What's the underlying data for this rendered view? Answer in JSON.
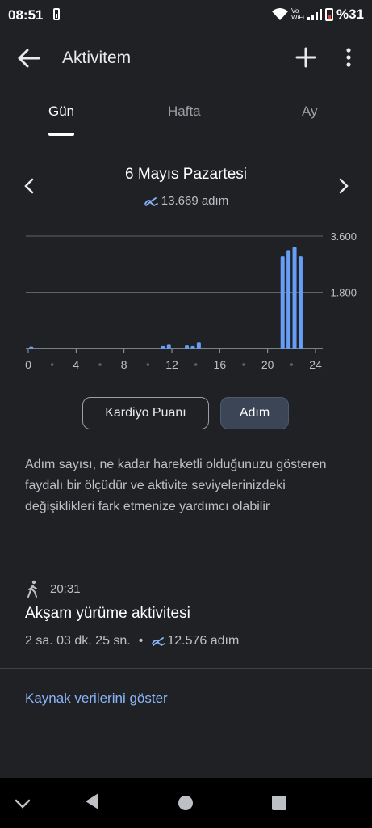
{
  "status": {
    "time": "08:51",
    "battery": "%31",
    "volte_top": "Vo",
    "volte_bottom": "WiFi"
  },
  "appbar": {
    "title": "Aktivitem"
  },
  "tabs": [
    {
      "label": "Gün"
    },
    {
      "label": "Hafta"
    },
    {
      "label": "Ay"
    }
  ],
  "day": {
    "title": "6 Mayıs Pazartesi",
    "steps": "13.669 adım"
  },
  "chart_data": {
    "type": "bar",
    "x": [
      0,
      0.5,
      1,
      1.5,
      2,
      2.5,
      3,
      3.5,
      4,
      4.5,
      5,
      5.5,
      6,
      6.5,
      7,
      7.5,
      8,
      8.5,
      9,
      9.5,
      10,
      10.5,
      11,
      11.5,
      12,
      12.5,
      13,
      13.5,
      14,
      14.5,
      15,
      15.5,
      16,
      16.5,
      17,
      17.5,
      18,
      18.5,
      19,
      19.5,
      20,
      20.5,
      21,
      21.5,
      22,
      22.5,
      23,
      23.5
    ],
    "values": [
      60,
      0,
      0,
      0,
      0,
      0,
      0,
      0,
      0,
      0,
      0,
      0,
      0,
      0,
      0,
      0,
      0,
      0,
      0,
      0,
      0,
      0,
      80,
      120,
      0,
      0,
      100,
      80,
      200,
      0,
      0,
      0,
      0,
      0,
      0,
      0,
      0,
      0,
      0,
      0,
      0,
      0,
      2950,
      3150,
      3250,
      2950,
      0,
      0
    ],
    "xticks": [
      "0",
      "4",
      "8",
      "12",
      "16",
      "20",
      "24"
    ],
    "yticks": [
      "3.600",
      "1.800"
    ],
    "ylim": [
      0,
      3600
    ],
    "xlim": [
      0,
      24
    ],
    "color": "#669df6"
  },
  "chips": {
    "cardio": "Kardiyo Puanı",
    "steps": "Adım"
  },
  "description": "Adım sayısı, ne kadar hareketli olduğunuzu gösteren faydalı bir ölçüdür ve aktivite seviyelerinizdeki değişiklikleri fark etmenize yardımcı olabilir",
  "session": {
    "time": "20:31",
    "title": "Akşam yürüme aktivitesi",
    "duration": "2 sa. 03 dk. 25 sn.",
    "separator": "•",
    "steps": "12.576 adım"
  },
  "source_link": "Kaynak verilerini göster",
  "colors": {
    "accent": "#8ab4f8",
    "bars": "#669df6",
    "background": "#202124"
  }
}
